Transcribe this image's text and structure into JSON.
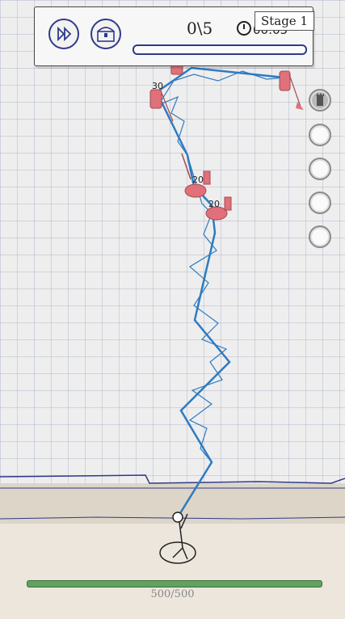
{
  "hud": {
    "kills": "0\\5",
    "timer": "00:05",
    "stage": "Stage 1",
    "wave_progress": 0
  },
  "icons": {
    "fast_forward": "fast-forward-icon",
    "treasure_chest": "treasure-chest-icon",
    "clock": "clock-icon",
    "tower": "tower-icon"
  },
  "enemies": [
    {
      "type": "knight",
      "hp": "30"
    },
    {
      "type": "knight",
      "hp": ""
    },
    {
      "type": "cavalry",
      "hp": "20"
    },
    {
      "type": "cavalry",
      "hp": "20"
    },
    {
      "type": "knight",
      "hp": ""
    }
  ],
  "player": {
    "health": "500/500",
    "health_fraction": 1.0
  },
  "skill_slots": [
    {
      "icon": "tower-icon",
      "active": true
    },
    {
      "icon": "",
      "active": false
    },
    {
      "icon": "",
      "active": false
    },
    {
      "icon": "",
      "active": false
    },
    {
      "icon": "",
      "active": false
    }
  ],
  "colors": {
    "lightning": "#2f7bc0",
    "enemy": "#e0707a",
    "ink": "#2f3a8a",
    "health": "#5fa35f"
  }
}
